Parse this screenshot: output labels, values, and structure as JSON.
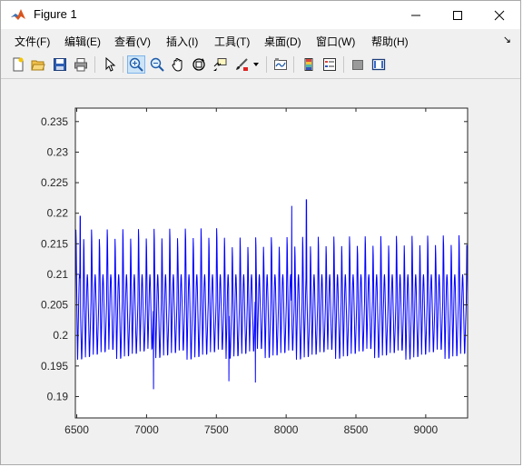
{
  "window": {
    "title": "Figure 1",
    "controls": [
      "minimize",
      "maximize",
      "close"
    ]
  },
  "menu": {
    "items": [
      {
        "label": "文件(F)"
      },
      {
        "label": "编辑(E)"
      },
      {
        "label": "查看(V)"
      },
      {
        "label": "插入(I)"
      },
      {
        "label": "工具(T)"
      },
      {
        "label": "桌面(D)"
      },
      {
        "label": "窗口(W)"
      },
      {
        "label": "帮助(H)"
      }
    ],
    "dock_icon": "↘"
  },
  "toolbar": {
    "buttons": [
      "new-figure-icon",
      "open-file-icon",
      "save-icon",
      "print-icon",
      "pointer-icon",
      "zoom-in-icon",
      "zoom-out-icon",
      "pan-hand-icon",
      "rotate-3d-icon",
      "data-cursor-icon",
      "brush-icon",
      "brush-dropdown-icon",
      "link-plot-icon",
      "colorbar-icon",
      "legend-icon",
      "hide-plot-tools-icon",
      "show-plot-tools-icon"
    ],
    "active": "zoom-in-icon"
  },
  "chart_data": {
    "type": "line",
    "title": "",
    "xlabel": "",
    "ylabel": "",
    "xlim": [
      6490,
      9300
    ],
    "ylim": [
      0.1865,
      0.2372
    ],
    "xticks": [
      6500,
      7000,
      7500,
      8000,
      8500,
      9000
    ],
    "xtick_labels": [
      "6500",
      "7000",
      "7500",
      "8000",
      "8500",
      "9000"
    ],
    "yticks": [
      0.19,
      0.195,
      0.2,
      0.205,
      0.21,
      0.215,
      0.22,
      0.225,
      0.23,
      0.235
    ],
    "ytick_labels": [
      "0.19",
      "0.195",
      "0.2",
      "0.205",
      "0.21",
      "0.215",
      "0.22",
      "0.225",
      "0.23",
      "0.235"
    ],
    "grid": false,
    "line_color": "#0000ff",
    "series": [
      {
        "period": 56,
        "baseline": 0.2055,
        "peak_range": [
          0.2155,
          0.219
        ],
        "trough_range": [
          0.1955,
          0.1975
        ],
        "outliers": [
          {
            "x": 7050,
            "y": 0.1912
          },
          {
            "x": 7590,
            "y": 0.1925
          },
          {
            "x": 7780,
            "y": 0.1923
          },
          {
            "x": 8145,
            "y": 0.2222
          },
          {
            "x": 8040,
            "y": 0.2212
          },
          {
            "x": 6525,
            "y": 0.2195
          }
        ]
      }
    ]
  }
}
